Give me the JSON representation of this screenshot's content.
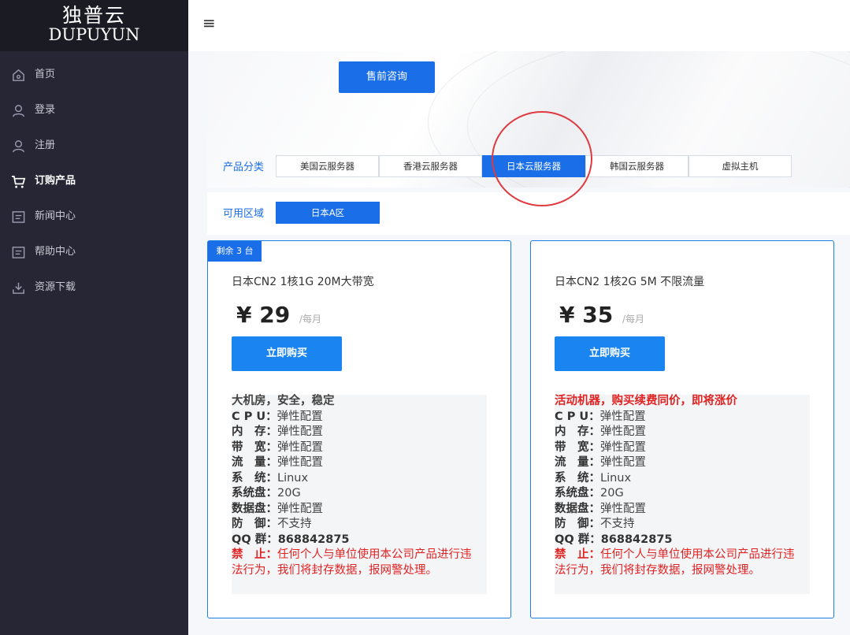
{
  "logo": {
    "cn": "独普云",
    "en": "DUPUYUN"
  },
  "header": {
    "menu_icon": "hamburger-icon",
    "menu_glyph": "≡"
  },
  "sidebar": {
    "items": [
      {
        "label": "首页",
        "icon": "home-icon"
      },
      {
        "label": "登录",
        "icon": "user-icon"
      },
      {
        "label": "注册",
        "icon": "user-icon"
      },
      {
        "label": "订购产品",
        "icon": "cart-icon",
        "active": true
      },
      {
        "label": "新闻中心",
        "icon": "news-icon"
      },
      {
        "label": "帮助中心",
        "icon": "help-icon"
      },
      {
        "label": "资源下载",
        "icon": "download-icon"
      }
    ]
  },
  "banner": {
    "consult_label": "售前咨询"
  },
  "category": {
    "label": "产品分类",
    "tabs": [
      "美国云服务器",
      "香港云服务器",
      "日本云服务器",
      "韩国云服务器",
      "虚拟主机"
    ],
    "selected": "日本云服务器"
  },
  "zone": {
    "label": "可用区域",
    "tabs": [
      "日本A区"
    ]
  },
  "colors": {
    "accent": "#1a6ee8",
    "sidebar": "#262635",
    "warning": "#e02424"
  },
  "products": [
    {
      "badge": "剩余 3 台",
      "title": "日本CN2 1核1G 20M大带宽",
      "price_symbol": "¥",
      "price": "29",
      "unit": "/每月",
      "buy_label": "立即购买",
      "headline": "大机房，安全，稳定",
      "headline_red": false,
      "specs": [
        {
          "k": "C P U：",
          "v": "弹性配置"
        },
        {
          "k": "内　存：",
          "v": "弹性配置"
        },
        {
          "k": "带　宽：",
          "v": "弹性配置"
        },
        {
          "k": "流　量：",
          "v": "弹性配置"
        },
        {
          "k": "系　统：",
          "v": "Linux"
        },
        {
          "k": "系统盘：",
          "v": "20G"
        },
        {
          "k": "数据盘：",
          "v": "弹性配置"
        },
        {
          "k": "防　御：",
          "v": "不支持"
        },
        {
          "k": "QQ 群：",
          "v": "868842875"
        }
      ],
      "warn_key": "禁　止：",
      "warn_text": "任何个人与单位使用本公司产品进行违法行为，我们将封存数据，报网警处理。"
    },
    {
      "badge": "",
      "title": "日本CN2 1核2G 5M 不限流量",
      "price_symbol": "¥",
      "price": "35",
      "unit": "/每月",
      "buy_label": "立即购买",
      "headline": "活动机器，购买续费同价，即将涨价",
      "headline_red": true,
      "specs": [
        {
          "k": "C P U：",
          "v": "弹性配置"
        },
        {
          "k": "内　存：",
          "v": "弹性配置"
        },
        {
          "k": "带　宽：",
          "v": "弹性配置"
        },
        {
          "k": "流　量：",
          "v": "弹性配置"
        },
        {
          "k": "系　统：",
          "v": "Linux"
        },
        {
          "k": "系统盘：",
          "v": "20G"
        },
        {
          "k": "数据盘：",
          "v": "弹性配置"
        },
        {
          "k": "防　御：",
          "v": "不支持"
        },
        {
          "k": "QQ 群：",
          "v": "868842875"
        }
      ],
      "warn_key": "禁　止：",
      "warn_text": "任何个人与单位使用本公司产品进行违法行为，我们将封存数据，报网警处理。"
    }
  ]
}
